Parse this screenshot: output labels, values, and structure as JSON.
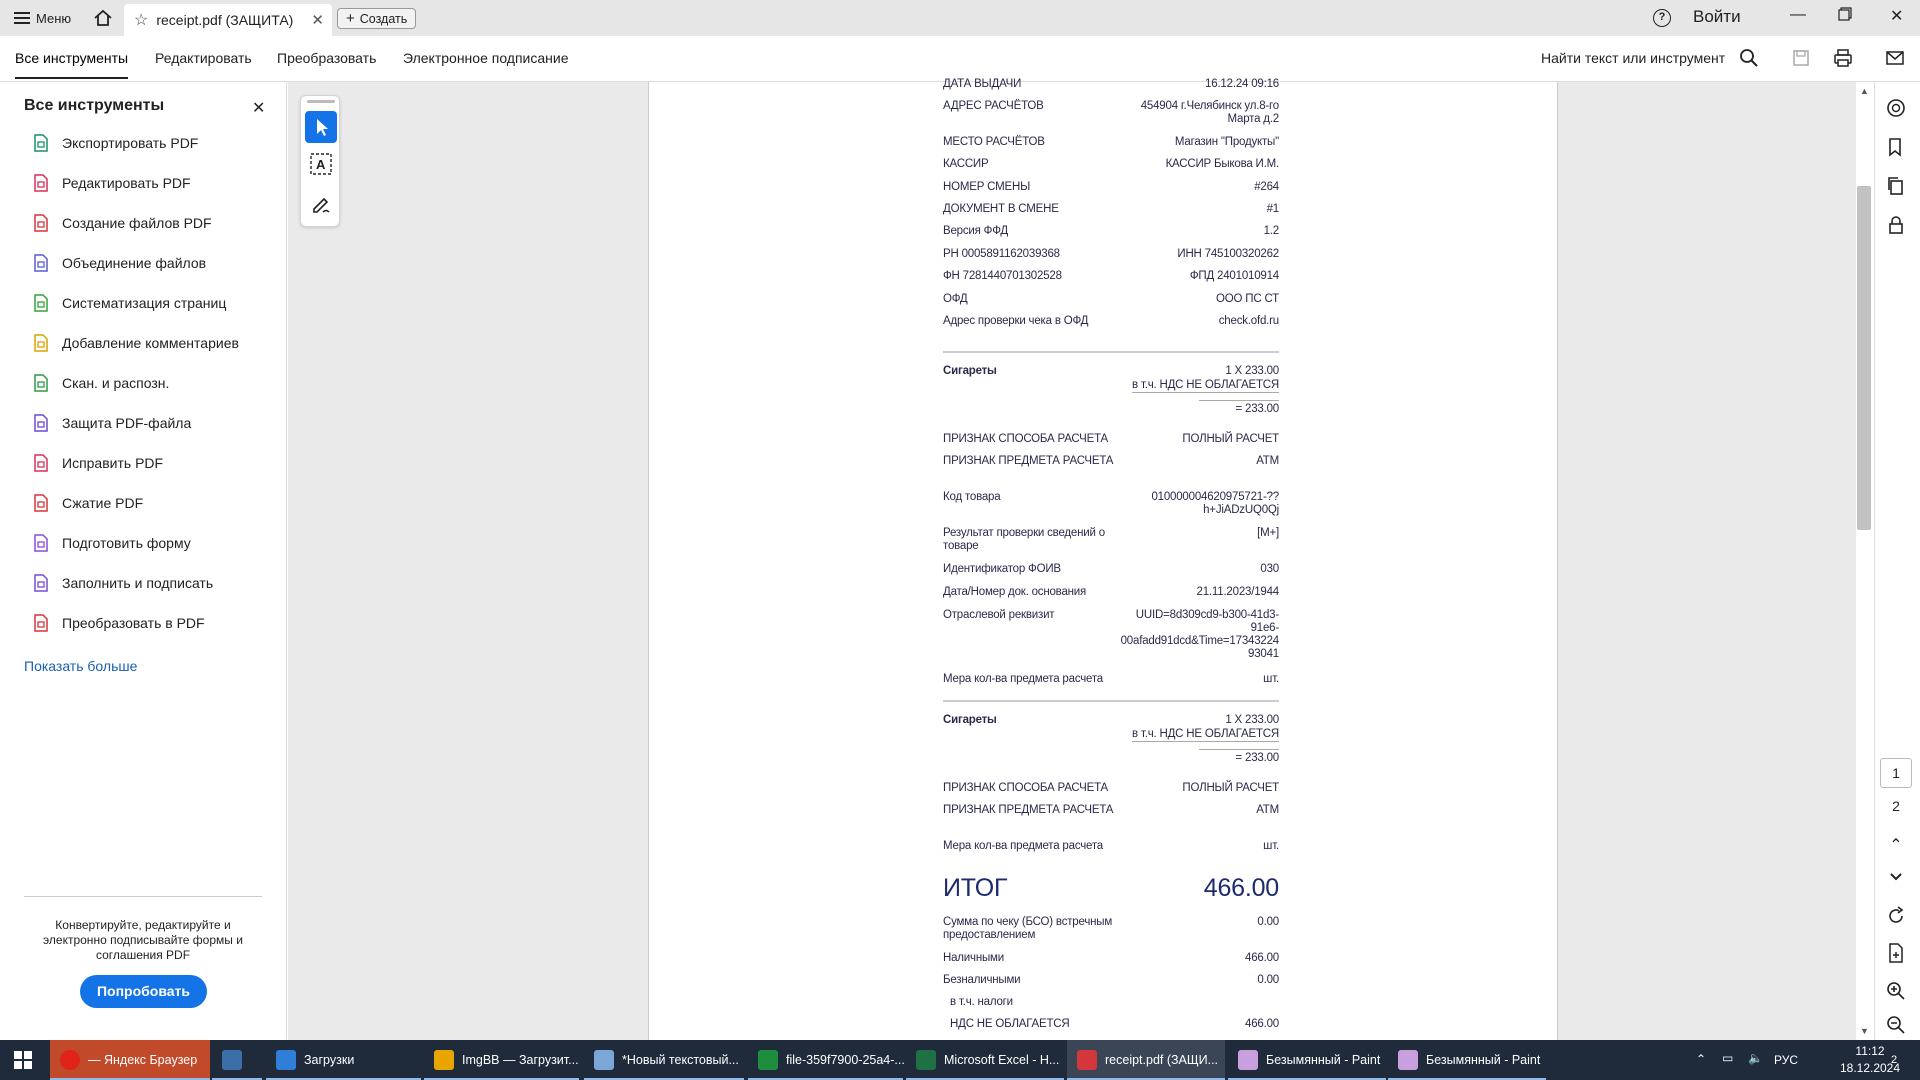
{
  "titlebar": {
    "menu_label": "Меню",
    "tab_title": "receipt.pdf (ЗАЩИТА)",
    "create_label": "Создать",
    "signin_label": "Войти",
    "help_glyph": "?"
  },
  "toolbar": {
    "tabs": [
      "Все инструменты",
      "Редактировать",
      "Преобразовать",
      "Электронное подписание"
    ],
    "find_label": "Найти текст или инструмент"
  },
  "left_panel": {
    "title": "Все инструменты",
    "tools": [
      {
        "label": "Экспортировать PDF",
        "icon": "export-pdf-icon",
        "color": "#1a8f6b"
      },
      {
        "label": "Редактировать PDF",
        "icon": "edit-pdf-icon",
        "color": "#d9305a"
      },
      {
        "label": "Создание файлов PDF",
        "icon": "create-pdf-icon",
        "color": "#d4373b"
      },
      {
        "label": "Объединение файлов",
        "icon": "combine-files-icon",
        "color": "#5b5bd6"
      },
      {
        "label": "Систематизация страниц",
        "icon": "organize-pages-icon",
        "color": "#35a03a"
      },
      {
        "label": "Добавление комментариев",
        "icon": "comment-icon",
        "color": "#d8a400"
      },
      {
        "label": "Скан. и распозн.",
        "icon": "scan-ocr-icon",
        "color": "#2e9a44"
      },
      {
        "label": "Защита PDF-файла",
        "icon": "protect-pdf-icon",
        "color": "#6a4bd6"
      },
      {
        "label": "Исправить PDF",
        "icon": "redact-pdf-icon",
        "color": "#d9305a"
      },
      {
        "label": "Сжатие PDF",
        "icon": "compress-pdf-icon",
        "color": "#d4373b"
      },
      {
        "label": "Подготовить форму",
        "icon": "prepare-form-icon",
        "color": "#8a4bd6"
      },
      {
        "label": "Заполнить и подписать",
        "icon": "fill-sign-icon",
        "color": "#7a4bd6"
      },
      {
        "label": "Преобразовать в PDF",
        "icon": "convert-pdf-icon",
        "color": "#d4373b"
      }
    ],
    "show_more": "Показать больше",
    "promo_text": "Конвертируйте, редактируйте и электронно подписывайте формы и соглашения PDF",
    "try_button": "Попробовать"
  },
  "receipt": {
    "rows_top": [
      {
        "l": "ДАТА ВЫДАЧИ",
        "r": "16.12.24 09:16"
      },
      {
        "l": "АДРЕС РАСЧЁТОВ",
        "r": "454904 г.Челябинск ул.8-го Марта д.2"
      },
      {
        "l": "МЕСТО РАСЧЁТОВ",
        "r": "Магазин \"Продукты\""
      },
      {
        "l": "КАССИР",
        "r": "КАССИР Быкова И.М."
      },
      {
        "l": "НОМЕР СМЕНЫ",
        "r": "#264"
      },
      {
        "l": "ДОКУМЕНТ В СМЕНЕ",
        "r": "#1"
      },
      {
        "l": "Версия ФФД",
        "r": "1.2"
      },
      {
        "l": "РН 0005891162039368",
        "r": "ИНН 745100320262"
      },
      {
        "l": "ФН 7281440701302528",
        "r": "ФПД 2401010914"
      },
      {
        "l": "ОФД",
        "r": "ООО ПС СТ"
      },
      {
        "l": "Адрес проверки чека в ОФД",
        "r": "check.ofd.ru"
      }
    ],
    "item1": {
      "name": "Сигареты",
      "qty_price": "1 X 233.00",
      "vat": "в т.ч. НДС НЕ ОБЛАГАЕТСЯ",
      "total": "= 233.00",
      "rows": [
        {
          "l": "ПРИЗНАК СПОСОБА РАСЧЕТА",
          "r": "ПОЛНЫЙ РАСЧЕТ"
        },
        {
          "l": "ПРИЗНАК ПРЕДМЕТА РАСЧЕТА",
          "r": "АТМ"
        },
        {
          "l": "Код товара",
          "r": "010000004620975721-?? h+JiADzUQ0Qj"
        },
        {
          "l": "Результат проверки сведений о товаре",
          "r": "[M+]"
        },
        {
          "l": "Идентификатор ФОИВ",
          "r": "030"
        },
        {
          "l": "Дата/Номер док. основания",
          "r": "21.11.2023/1944"
        },
        {
          "l": "Отраслевой реквизит",
          "r": "UUID=8d309cd9-b300-41d3-91e6-00afadd91dcd&Time=17343224 93041"
        },
        {
          "l": "Мера кол-ва предмета расчета",
          "r": "шт."
        }
      ]
    },
    "item2": {
      "name": "Сигареты",
      "qty_price": "1 X 233.00",
      "vat": "в т.ч. НДС НЕ ОБЛАГАЕТСЯ",
      "total": "= 233.00",
      "rows": [
        {
          "l": "ПРИЗНАК СПОСОБА РАСЧЕТА",
          "r": "ПОЛНЫЙ РАСЧЕТ"
        },
        {
          "l": "ПРИЗНАК ПРЕДМЕТА РАСЧЕТА",
          "r": "АТМ"
        },
        {
          "l": "Мера кол-ва предмета расчета",
          "r": "шт."
        }
      ]
    },
    "total_label": "ИТОГ",
    "total_value": "466.00",
    "rows_bottom": [
      {
        "l": "Сумма по чеку (БСО) встречным предоставлением",
        "r": "0.00"
      },
      {
        "l": "Наличными",
        "r": "466.00"
      },
      {
        "l": "Безналичными",
        "r": "0.00"
      },
      {
        "l": "в т.ч. налоги",
        "r": ""
      },
      {
        "l": "НДС НЕ ОБЛАГАЕТСЯ",
        "r": "466.00"
      }
    ]
  },
  "page_nav": {
    "page1": "1",
    "page2": "2"
  },
  "taskbar": {
    "items": [
      {
        "label": "— Яндекс Браузер",
        "color": "#e2231a"
      },
      {
        "label": "",
        "color": "#3c6ea8"
      },
      {
        "label": "Загрузки",
        "color": "#2f7fd8"
      },
      {
        "label": "ImgBB — Загрузит...",
        "color": "#e8a500"
      },
      {
        "label": "*Новый текстовый...",
        "color": "#7ba7d6"
      },
      {
        "label": "file-359f7900-25a4-...",
        "color": "#1e8e3e"
      },
      {
        "label": "Microsoft Excel - H...",
        "color": "#1e7145"
      },
      {
        "label": "receipt.pdf (ЗАЩИ...",
        "color": "#d4373b"
      },
      {
        "label": "Безымянный - Paint",
        "color": "#c8a0e0"
      },
      {
        "label": "Безымянный - Paint",
        "color": "#c8a0e0"
      }
    ],
    "lang": "РУС",
    "time": "11:12",
    "date": "18.12.2024",
    "notif_count": "2"
  }
}
